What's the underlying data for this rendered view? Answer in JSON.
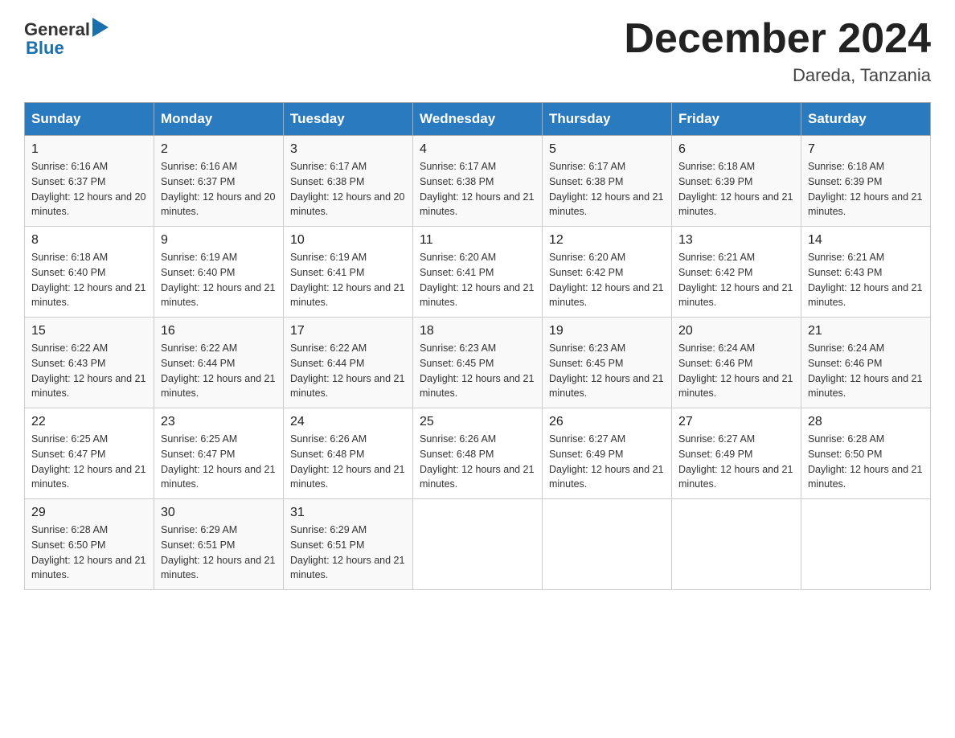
{
  "header": {
    "logo_general": "General",
    "logo_blue": "Blue",
    "month_title": "December 2024",
    "location": "Dareda, Tanzania"
  },
  "columns": [
    "Sunday",
    "Monday",
    "Tuesday",
    "Wednesday",
    "Thursday",
    "Friday",
    "Saturday"
  ],
  "weeks": [
    [
      {
        "day": "1",
        "sunrise": "6:16 AM",
        "sunset": "6:37 PM",
        "daylight": "12 hours and 20 minutes."
      },
      {
        "day": "2",
        "sunrise": "6:16 AM",
        "sunset": "6:37 PM",
        "daylight": "12 hours and 20 minutes."
      },
      {
        "day": "3",
        "sunrise": "6:17 AM",
        "sunset": "6:38 PM",
        "daylight": "12 hours and 20 minutes."
      },
      {
        "day": "4",
        "sunrise": "6:17 AM",
        "sunset": "6:38 PM",
        "daylight": "12 hours and 21 minutes."
      },
      {
        "day": "5",
        "sunrise": "6:17 AM",
        "sunset": "6:38 PM",
        "daylight": "12 hours and 21 minutes."
      },
      {
        "day": "6",
        "sunrise": "6:18 AM",
        "sunset": "6:39 PM",
        "daylight": "12 hours and 21 minutes."
      },
      {
        "day": "7",
        "sunrise": "6:18 AM",
        "sunset": "6:39 PM",
        "daylight": "12 hours and 21 minutes."
      }
    ],
    [
      {
        "day": "8",
        "sunrise": "6:18 AM",
        "sunset": "6:40 PM",
        "daylight": "12 hours and 21 minutes."
      },
      {
        "day": "9",
        "sunrise": "6:19 AM",
        "sunset": "6:40 PM",
        "daylight": "12 hours and 21 minutes."
      },
      {
        "day": "10",
        "sunrise": "6:19 AM",
        "sunset": "6:41 PM",
        "daylight": "12 hours and 21 minutes."
      },
      {
        "day": "11",
        "sunrise": "6:20 AM",
        "sunset": "6:41 PM",
        "daylight": "12 hours and 21 minutes."
      },
      {
        "day": "12",
        "sunrise": "6:20 AM",
        "sunset": "6:42 PM",
        "daylight": "12 hours and 21 minutes."
      },
      {
        "day": "13",
        "sunrise": "6:21 AM",
        "sunset": "6:42 PM",
        "daylight": "12 hours and 21 minutes."
      },
      {
        "day": "14",
        "sunrise": "6:21 AM",
        "sunset": "6:43 PM",
        "daylight": "12 hours and 21 minutes."
      }
    ],
    [
      {
        "day": "15",
        "sunrise": "6:22 AM",
        "sunset": "6:43 PM",
        "daylight": "12 hours and 21 minutes."
      },
      {
        "day": "16",
        "sunrise": "6:22 AM",
        "sunset": "6:44 PM",
        "daylight": "12 hours and 21 minutes."
      },
      {
        "day": "17",
        "sunrise": "6:22 AM",
        "sunset": "6:44 PM",
        "daylight": "12 hours and 21 minutes."
      },
      {
        "day": "18",
        "sunrise": "6:23 AM",
        "sunset": "6:45 PM",
        "daylight": "12 hours and 21 minutes."
      },
      {
        "day": "19",
        "sunrise": "6:23 AM",
        "sunset": "6:45 PM",
        "daylight": "12 hours and 21 minutes."
      },
      {
        "day": "20",
        "sunrise": "6:24 AM",
        "sunset": "6:46 PM",
        "daylight": "12 hours and 21 minutes."
      },
      {
        "day": "21",
        "sunrise": "6:24 AM",
        "sunset": "6:46 PM",
        "daylight": "12 hours and 21 minutes."
      }
    ],
    [
      {
        "day": "22",
        "sunrise": "6:25 AM",
        "sunset": "6:47 PM",
        "daylight": "12 hours and 21 minutes."
      },
      {
        "day": "23",
        "sunrise": "6:25 AM",
        "sunset": "6:47 PM",
        "daylight": "12 hours and 21 minutes."
      },
      {
        "day": "24",
        "sunrise": "6:26 AM",
        "sunset": "6:48 PM",
        "daylight": "12 hours and 21 minutes."
      },
      {
        "day": "25",
        "sunrise": "6:26 AM",
        "sunset": "6:48 PM",
        "daylight": "12 hours and 21 minutes."
      },
      {
        "day": "26",
        "sunrise": "6:27 AM",
        "sunset": "6:49 PM",
        "daylight": "12 hours and 21 minutes."
      },
      {
        "day": "27",
        "sunrise": "6:27 AM",
        "sunset": "6:49 PM",
        "daylight": "12 hours and 21 minutes."
      },
      {
        "day": "28",
        "sunrise": "6:28 AM",
        "sunset": "6:50 PM",
        "daylight": "12 hours and 21 minutes."
      }
    ],
    [
      {
        "day": "29",
        "sunrise": "6:28 AM",
        "sunset": "6:50 PM",
        "daylight": "12 hours and 21 minutes."
      },
      {
        "day": "30",
        "sunrise": "6:29 AM",
        "sunset": "6:51 PM",
        "daylight": "12 hours and 21 minutes."
      },
      {
        "day": "31",
        "sunrise": "6:29 AM",
        "sunset": "6:51 PM",
        "daylight": "12 hours and 21 minutes."
      },
      null,
      null,
      null,
      null
    ]
  ]
}
